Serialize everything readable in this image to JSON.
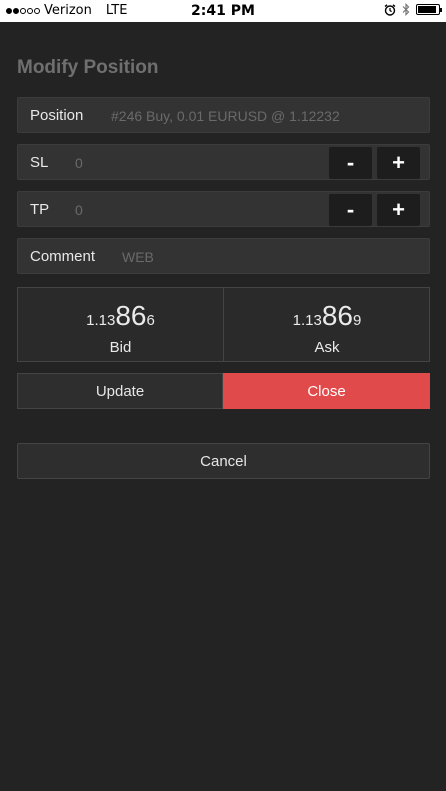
{
  "status_bar": {
    "carrier": "Verizon",
    "network": "LTE",
    "time": "2:41 PM",
    "signal_bars_filled": 2,
    "signal_bars_total": 5,
    "alarm_icon": "alarm-icon",
    "bluetooth_icon": "bluetooth-icon",
    "battery_level": 0.9
  },
  "title": "Modify Position",
  "position": {
    "label": "Position",
    "value": "#246 Buy, 0.01 EURUSD @ 1.12232"
  },
  "sl": {
    "label": "SL",
    "placeholder": "0",
    "minus_label": "-",
    "plus_label": "+"
  },
  "tp": {
    "label": "TP",
    "placeholder": "0",
    "minus_label": "-",
    "plus_label": "+"
  },
  "comment": {
    "label": "Comment",
    "placeholder": "WEB"
  },
  "bid": {
    "price_prefix": "1.13",
    "price_big": "86",
    "price_suffix": "6",
    "label": "Bid"
  },
  "ask": {
    "price_prefix": "1.13",
    "price_big": "86",
    "price_suffix": "9",
    "label": "Ask"
  },
  "actions": {
    "update_label": "Update",
    "close_label": "Close",
    "cancel_label": "Cancel"
  },
  "colors": {
    "background": "#232323",
    "close_button": "#e04a4a",
    "title": "#6f6f6f"
  }
}
